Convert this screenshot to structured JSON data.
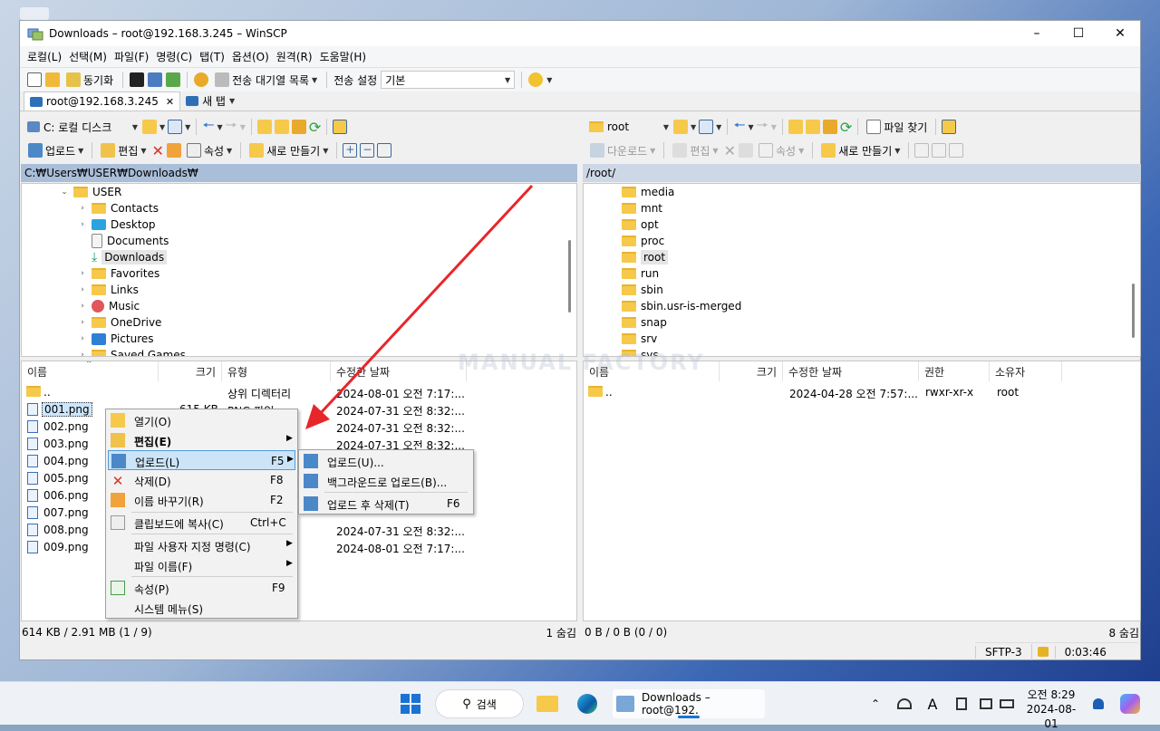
{
  "window": {
    "title": "Downloads – root@192.168.3.245 – WinSCP"
  },
  "menubar": [
    "로컬(L)",
    "선택(M)",
    "파일(F)",
    "명령(C)",
    "탭(T)",
    "옵션(O)",
    "원격(R)",
    "도움말(H)"
  ],
  "toolbar": {
    "sync": "동기화",
    "queue": "전송 대기열 목록",
    "transfer_settings_label": "전송 설정",
    "transfer_settings_value": "기본"
  },
  "tabs": [
    {
      "label": "root@192.168.3.245",
      "close": "✕"
    },
    {
      "label": "새 탭"
    }
  ],
  "left": {
    "drive": "C: 로컬 디스크",
    "actions": {
      "upload": "업로드",
      "edit": "편집",
      "props": "속성",
      "new": "새로 만들기"
    },
    "path": "C:₩Users₩USER₩Downloads₩",
    "tree": [
      {
        "label": "USER",
        "exp": "⌄"
      },
      {
        "label": "Contacts",
        "exp": "›"
      },
      {
        "label": "Desktop",
        "exp": "›"
      },
      {
        "label": "Documents",
        "exp": ""
      },
      {
        "label": "Downloads",
        "exp": ""
      },
      {
        "label": "Favorites",
        "exp": "›"
      },
      {
        "label": "Links",
        "exp": "›"
      },
      {
        "label": "Music",
        "exp": "›"
      },
      {
        "label": "OneDrive",
        "exp": "›"
      },
      {
        "label": "Pictures",
        "exp": "›"
      },
      {
        "label": "Saved Games",
        "exp": "›"
      }
    ],
    "columns": [
      "이름",
      "크기",
      "유형",
      "수정한 날짜"
    ],
    "rows": [
      {
        "name": "..",
        "size": "",
        "type": "상위 디렉터리",
        "date": "2024-08-01 오전 7:17:..."
      },
      {
        "name": "001.png",
        "size": "615 KB",
        "type": "PNG 파일",
        "date": "2024-07-31 오전 8:32:..."
      },
      {
        "name": "002.png",
        "size": "",
        "type": "",
        "date": "2024-07-31 오전 8:32:..."
      },
      {
        "name": "003.png",
        "size": "",
        "type": "",
        "date": "2024-07-31 오전 8:32:..."
      },
      {
        "name": "004.png",
        "size": "",
        "type": "",
        "date": ""
      },
      {
        "name": "005.png",
        "size": "",
        "type": "",
        "date": ""
      },
      {
        "name": "006.png",
        "size": "",
        "type": "",
        "date": ""
      },
      {
        "name": "007.png",
        "size": "",
        "type": "",
        "date": ""
      },
      {
        "name": "008.png",
        "size": "",
        "type": "",
        "date": "2024-07-31 오전 8:32:..."
      },
      {
        "name": "009.png",
        "size": "",
        "type": "",
        "date": "2024-08-01 오전 7:17:..."
      }
    ],
    "status": "614 KB / 2.91 MB (1 / 9)",
    "hidden": "1 숨김"
  },
  "right": {
    "dir": "root",
    "find": "파일 찾기",
    "actions": {
      "download": "다운로드",
      "edit": "편집",
      "props": "속성",
      "new": "새로 만들기"
    },
    "path": "/root/",
    "tree": [
      "media",
      "mnt",
      "opt",
      "proc",
      "root",
      "run",
      "sbin",
      "sbin.usr-is-merged",
      "snap",
      "srv",
      "sys"
    ],
    "columns": [
      "이름",
      "크기",
      "수정한 날짜",
      "권한",
      "소유자"
    ],
    "rows": [
      {
        "name": "..",
        "size": "",
        "date": "2024-04-28 오전 7:57:...",
        "perm": "rwxr-xr-x",
        "owner": "root"
      }
    ],
    "status": "0 B / 0 B (0 / 0)",
    "hidden": "8 숨김"
  },
  "bottom": {
    "protocol": "SFTP-3",
    "elapsed": "0:03:46"
  },
  "context_menu": [
    {
      "label": "열기(O)",
      "shortcut": "",
      "arrow": ""
    },
    {
      "label": "편집(E)",
      "shortcut": "",
      "arrow": "▶"
    },
    {
      "label": "업로드(L)",
      "shortcut": "F5",
      "arrow": "▶"
    },
    {
      "label": "삭제(D)",
      "shortcut": "F8",
      "arrow": ""
    },
    {
      "label": "이름 바꾸기(R)",
      "shortcut": "F2",
      "arrow": ""
    },
    {
      "label": "클립보드에 복사(C)",
      "shortcut": "Ctrl+C",
      "arrow": ""
    },
    {
      "label": "파일 사용자 지정 명령(C)",
      "shortcut": "",
      "arrow": "▶"
    },
    {
      "label": "파일 이름(F)",
      "shortcut": "",
      "arrow": "▶"
    },
    {
      "label": "속성(P)",
      "shortcut": "F9",
      "arrow": ""
    },
    {
      "label": "시스템 메뉴(S)",
      "shortcut": "",
      "arrow": ""
    }
  ],
  "submenu": [
    {
      "label": "업로드(U)...",
      "shortcut": ""
    },
    {
      "label": "백그라운드로 업로드(B)...",
      "shortcut": ""
    },
    {
      "label": "업로드 후 삭제(T)",
      "shortcut": "F6"
    }
  ],
  "watermark": "MANUAL FACTORY",
  "taskbar": {
    "search": "검색",
    "app": "Downloads – root@192.",
    "time": "오전 8:29",
    "date": "2024-08-01",
    "ime": "A"
  },
  "colors": {
    "arrow": "#e8262a",
    "path_active": "#a9bed8",
    "highlight": "#cce4f7"
  }
}
